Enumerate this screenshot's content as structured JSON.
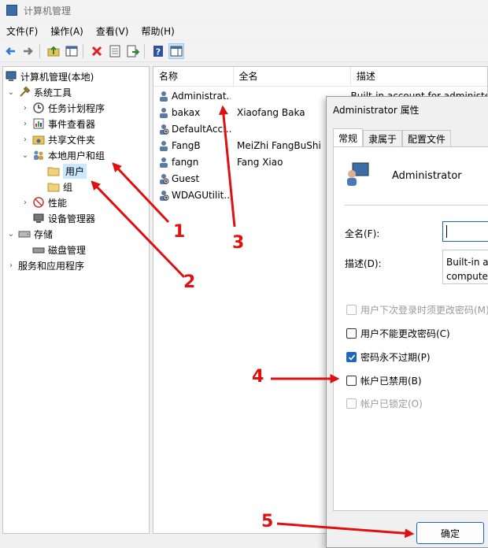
{
  "window": {
    "title": "计算机管理"
  },
  "menu": [
    "文件(F)",
    "操作(A)",
    "查看(V)",
    "帮助(H)"
  ],
  "toolbar": [
    "back-arrow-icon",
    "forward-arrow-icon",
    "up-folder-icon",
    "show-tree-icon",
    "delete-icon",
    "properties-icon",
    "export-icon",
    "help-icon",
    "show-pane-icon"
  ],
  "tree": {
    "root": "计算机管理(本地)",
    "system_tools": "系统工具",
    "task_scheduler": "任务计划程序",
    "event_viewer": "事件查看器",
    "shared_folders": "共享文件夹",
    "local_users_groups": "本地用户和组",
    "users": "用户",
    "groups": "组",
    "performance": "性能",
    "device_manager": "设备管理器",
    "storage": "存储",
    "disk_management": "磁盘管理",
    "services_apps": "服务和应用程序"
  },
  "list": {
    "headers": [
      "名称",
      "全名",
      "描述"
    ],
    "rows": [
      {
        "name": "Administrat...",
        "full": "",
        "desc": "Built-in account for administe"
      },
      {
        "name": "bakax",
        "full": "Xiaofang Baka",
        "desc": ""
      },
      {
        "name": "DefaultAcc...",
        "full": "",
        "desc": ""
      },
      {
        "name": "FangB",
        "full": "MeiZhi FangBuShi",
        "desc": ""
      },
      {
        "name": "fangn",
        "full": "Fang Xiao",
        "desc": ""
      },
      {
        "name": "Guest",
        "full": "",
        "desc": ""
      },
      {
        "name": "WDAGUtilit...",
        "full": "",
        "desc": ""
      }
    ]
  },
  "dialog": {
    "title": "Administrator 属性",
    "tabs": [
      "常规",
      "隶属于",
      "配置文件"
    ],
    "username": "Administrator",
    "fullname_label": "全名(F):",
    "fullname_value": "",
    "desc_label": "描述(D):",
    "desc_line1": "Built-in acc",
    "desc_line2": "computer",
    "checkboxes": [
      {
        "label": "用户下次登录时须更改密码(M)",
        "checked": false,
        "disabled": true
      },
      {
        "label": "用户不能更改密码(C)",
        "checked": false,
        "disabled": false
      },
      {
        "label": "密码永不过期(P)",
        "checked": true,
        "disabled": false
      },
      {
        "label": "帐户已禁用(B)",
        "checked": false,
        "disabled": false
      },
      {
        "label": "帐户已锁定(O)",
        "checked": false,
        "disabled": true
      }
    ],
    "ok_label": "确定"
  },
  "annotations": [
    "1",
    "2",
    "3",
    "4",
    "5"
  ],
  "colors": {
    "annotation": "#e01010",
    "selection": "#cce8ff",
    "accent": "#1a66c2"
  }
}
